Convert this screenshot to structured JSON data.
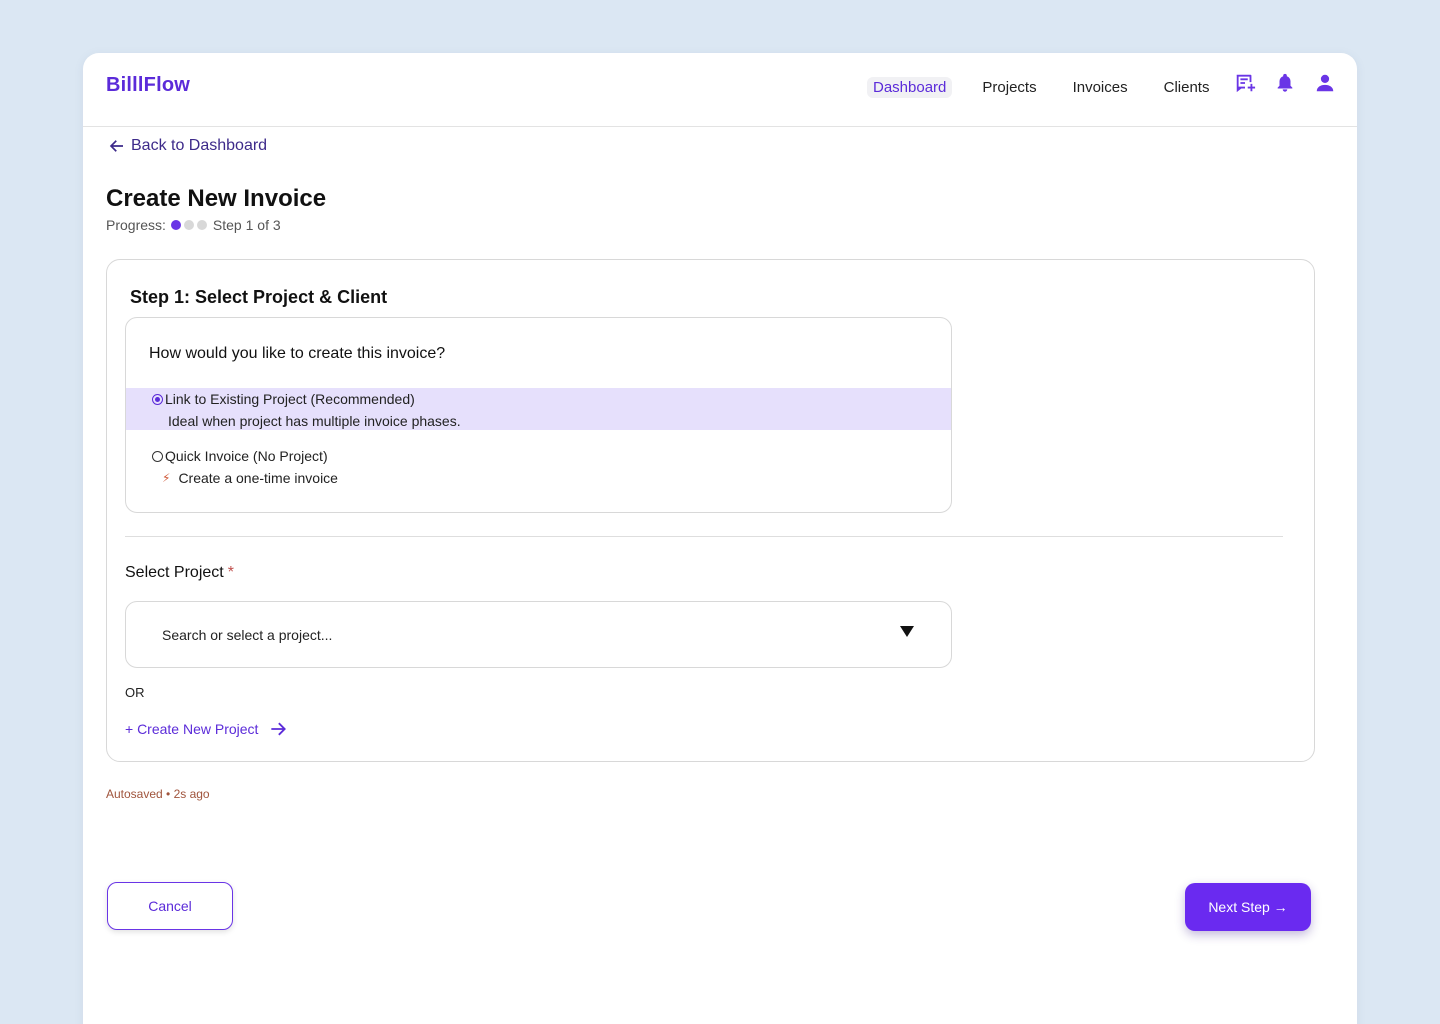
{
  "brand": "BilllFlow",
  "nav": {
    "items": [
      "Dashboard",
      "Projects",
      "Invoices",
      "Clients"
    ],
    "active": "Dashboard"
  },
  "header_icons": [
    "add-note-icon",
    "bell-icon",
    "user-icon"
  ],
  "back_link": "Back to Dashboard",
  "page_title": "Create New Invoice",
  "progress": {
    "label": "Progress:",
    "step_text": "Step 1 of 3",
    "current_step": 1,
    "total_steps": 3
  },
  "step": {
    "title": "Step 1: Select Project & Client",
    "question": "How would you like to create this invoice?",
    "options": [
      {
        "label": "Link to Existing Project (Recommended)",
        "description": "Ideal when project has multiple invoice phases.",
        "selected": true
      },
      {
        "label": "Quick Invoice (No Project)",
        "description": "Create a one-time invoice",
        "selected": false
      }
    ],
    "project_field": {
      "label": "Select Project",
      "required_mark": "*",
      "placeholder": "Search or select a project..."
    },
    "or_text": "OR",
    "create_link": "+ Create New Project"
  },
  "autosave": "Autosaved • 2s ago",
  "buttons": {
    "cancel": "Cancel",
    "next": "Next Step →"
  },
  "colors": {
    "accent": "#6a2af0",
    "selected_bg": "#e6e0fc",
    "page_bg": "#dbe7f3"
  }
}
